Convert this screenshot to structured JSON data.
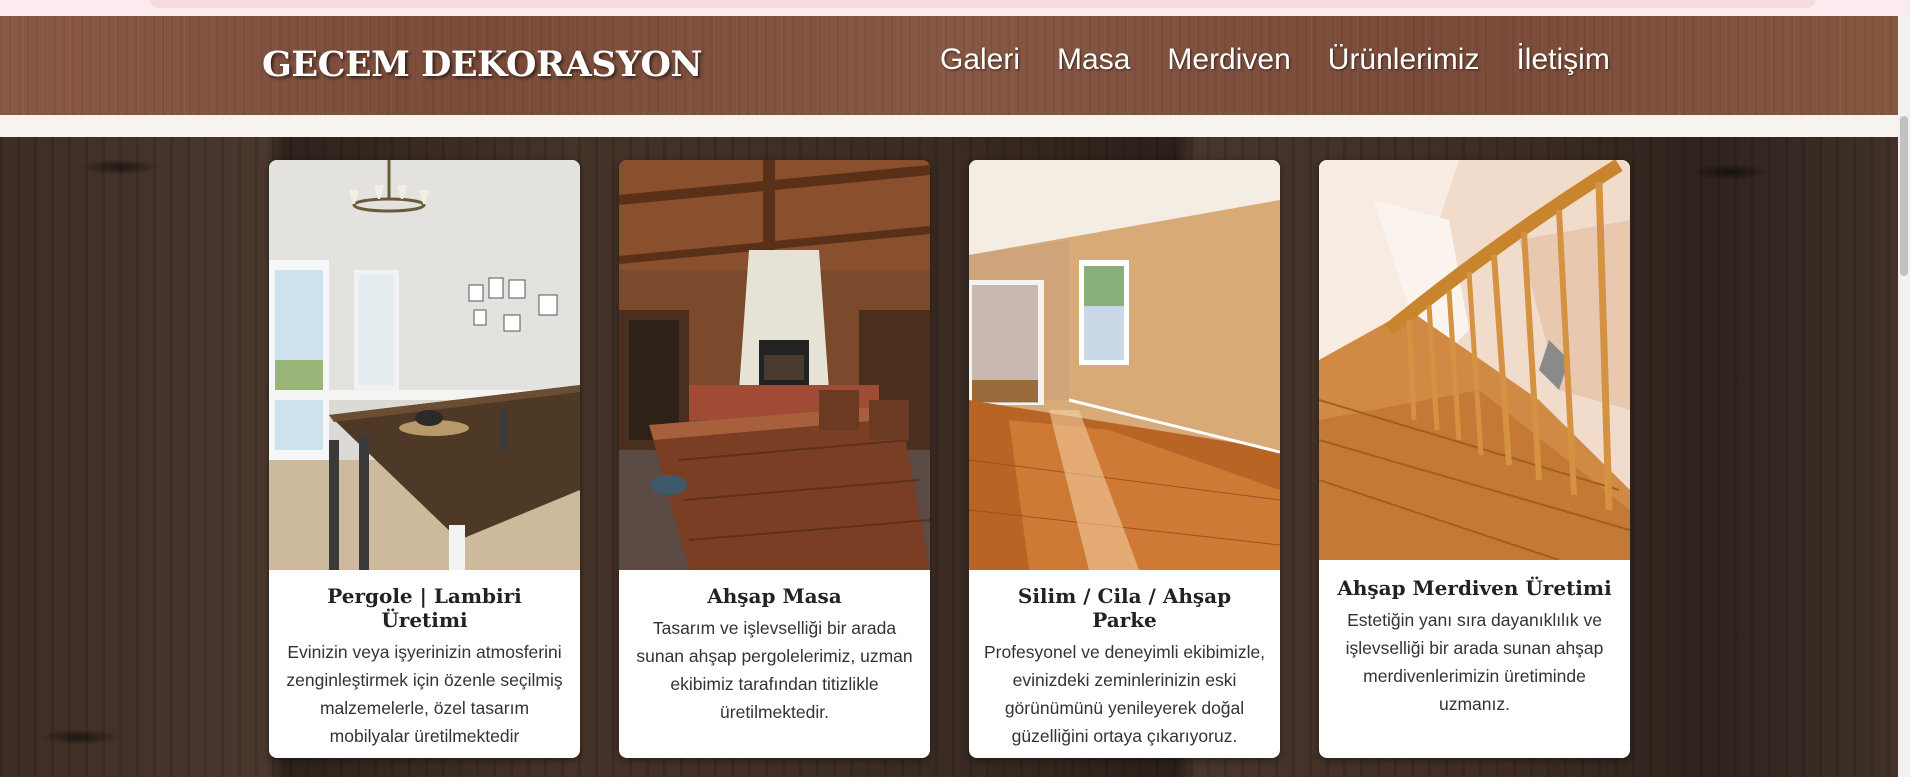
{
  "header": {
    "brand": "GECEM DEKORASYON",
    "nav": [
      "Galeri",
      "Masa",
      "Merdiven",
      "Ürünlerimiz",
      "İletişim"
    ]
  },
  "cards": [
    {
      "title": "Pergole | Lambiri Üretimi",
      "text": "Evinizin veya işyerinizin atmosferini zenginleştirmek için özenle seçilmiş malzemelerle, özel tasarım mobilyalar üretilmektedir",
      "image": "dining-room-photo"
    },
    {
      "title": "Ahşap Masa",
      "text": "Tasarım ve işlevselliği bir arada sunan ahşap pergolelerimiz, uzman ekibimiz tarafından titizlikle üretilmektedir.",
      "image": "patio-table-photo"
    },
    {
      "title": "Silim / Cila / Ahşap Parke",
      "text": "Profesyonel ve deneyimli ekibimizle, evinizdeki zeminlerinizin eski görünümünü yenileyerek doğal güzelliğini ortaya çıkarıyoruz.",
      "image": "parquet-floor-photo"
    },
    {
      "title": "Ahşap Merdiven Üretimi",
      "text": "Estetiğin yanı sıra dayanıklılık ve işlevselliği bir arada sunan ahşap merdivenlerimizin üretiminde uzmanız.",
      "image": "wooden-stairs-photo"
    }
  ],
  "colors": {
    "header_wood": "#7b4c3a",
    "main_wood": "#3a2b23",
    "card_bg": "#ffffff"
  }
}
